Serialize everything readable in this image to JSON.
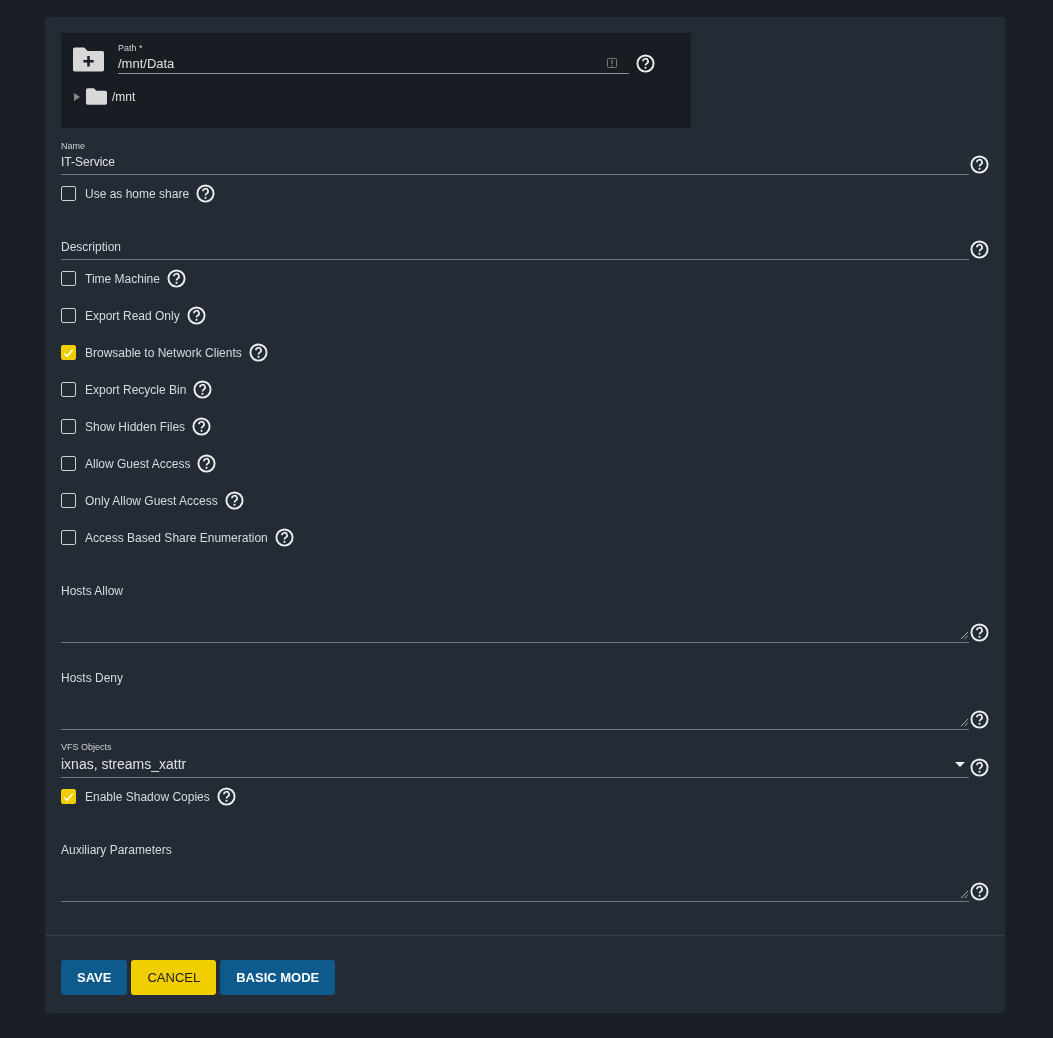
{
  "path_field": {
    "label": "Path *",
    "value": "/mnt/Data",
    "tree": [
      {
        "label": "/mnt",
        "expanded": false
      }
    ]
  },
  "fields": [
    {
      "kind": "input",
      "label": "Name",
      "value": "IT-Service"
    },
    {
      "kind": "checkbox",
      "label": "Use as home share",
      "checked": false
    },
    {
      "kind": "input",
      "placeholder": "Description"
    },
    {
      "kind": "checkbox",
      "label": "Time Machine",
      "checked": false
    },
    {
      "kind": "checkbox",
      "label": "Export Read Only",
      "checked": false
    },
    {
      "kind": "checkbox",
      "label": "Browsable to Network Clients",
      "checked": true
    },
    {
      "kind": "checkbox",
      "label": "Export Recycle Bin",
      "checked": false
    },
    {
      "kind": "checkbox",
      "label": "Show Hidden Files",
      "checked": false
    },
    {
      "kind": "checkbox",
      "label": "Allow Guest Access",
      "checked": false
    },
    {
      "kind": "checkbox",
      "label": "Only Allow Guest Access",
      "checked": false
    },
    {
      "kind": "checkbox",
      "label": "Access Based Share Enumeration",
      "checked": false
    },
    {
      "kind": "textarea",
      "label": "Hosts Allow"
    },
    {
      "kind": "textarea",
      "label": "Hosts Deny"
    },
    {
      "kind": "select",
      "label": "VFS Objects",
      "value": "ixnas, streams_xattr"
    },
    {
      "kind": "checkbox",
      "label": "Enable Shadow Copies",
      "checked": true
    },
    {
      "kind": "textarea",
      "label": "Auxiliary Parameters"
    }
  ],
  "buttons": [
    {
      "label": "SAVE",
      "kind": "primary"
    },
    {
      "label": "CANCEL",
      "kind": "accent"
    },
    {
      "label": "BASIC MODE",
      "kind": "primary"
    }
  ]
}
